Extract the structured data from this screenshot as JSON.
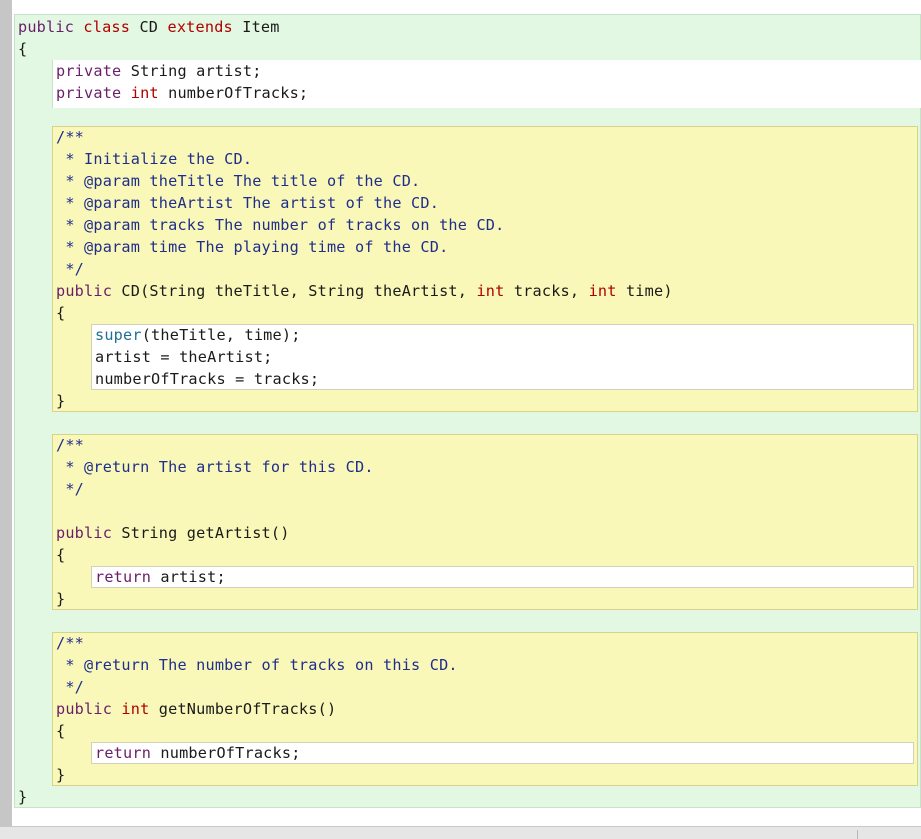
{
  "window": {
    "title": ""
  },
  "code": {
    "class_decl": {
      "kw_public": "public",
      "kw_class": "class",
      "name": "CD",
      "kw_extends": "extends",
      "parent": "Item"
    },
    "open_class": "{",
    "fields": [
      {
        "kw_private": "private",
        "type": "String",
        "name": "artist;"
      },
      {
        "kw_private": "private",
        "type_kw": "int",
        "name": "numberOfTracks;"
      }
    ],
    "constructor": {
      "comment": [
        "/**",
        " * Initialize the CD.",
        " * @param theTitle The title of the CD.",
        " * @param theArtist The artist of the CD.",
        " * @param tracks The number of tracks on the CD.",
        " * @param time The playing time of the CD.",
        " */"
      ],
      "sig_public": "public",
      "sig_a": "CD(String theTitle, String theArtist,",
      "sig_int1": "int",
      "sig_b": "tracks,",
      "sig_int2": "int",
      "sig_c": "time)",
      "open": "{",
      "body_super": "super",
      "body_super_rest": "(theTitle, time);",
      "body_2": "artist = theArtist;",
      "body_3": "numberOfTracks = tracks;",
      "close": "}"
    },
    "getArtist": {
      "comment": [
        "/**",
        " * @return The artist for this CD.",
        " */"
      ],
      "sig_public": "public",
      "sig_rest": "String getArtist()",
      "open": "{",
      "body_return": "return",
      "body_rest": "artist;",
      "close": "}"
    },
    "getNumberOfTracks": {
      "comment": [
        "/**",
        " * @return The number of tracks on this CD.",
        " */"
      ],
      "sig_public": "public",
      "sig_int": "int",
      "sig_rest": "getNumberOfTracks()",
      "open": "{",
      "body_return": "return",
      "body_rest": "numberOfTracks;",
      "close": "}"
    },
    "close_class": "}"
  },
  "colors": {
    "class_scope": "#e2f8e2",
    "method_scope": "#f9f8b8",
    "body_scope": "#ffffff",
    "keyword": "#b10000",
    "comment": "#1f2d8c",
    "gutter": "#c6c6c6"
  }
}
